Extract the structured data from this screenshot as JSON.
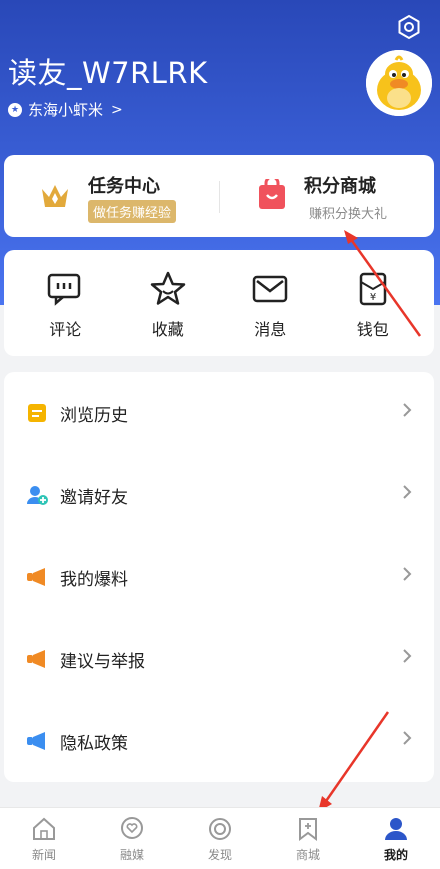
{
  "profile": {
    "username": "读友_W7RLRK",
    "level_label": "东海小虾米"
  },
  "top_card": {
    "task_title": "任务中心",
    "task_tag": "做任务赚经验",
    "shop_title": "积分商城",
    "shop_subtitle": "赚积分换大礼"
  },
  "quick_actions": [
    {
      "label": "评论",
      "icon": "comment-icon"
    },
    {
      "label": "收藏",
      "icon": "star-icon"
    },
    {
      "label": "消息",
      "icon": "mail-icon"
    },
    {
      "label": "钱包",
      "icon": "wallet-icon"
    }
  ],
  "menu": [
    {
      "label": "浏览历史",
      "icon": "history-icon",
      "color": "#f5b400"
    },
    {
      "label": "邀请好友",
      "icon": "invite-friend-icon",
      "color": "#3b8ef0"
    },
    {
      "label": "我的爆料",
      "icon": "megaphone-icon",
      "color": "#f08a24"
    },
    {
      "label": "建议与举报",
      "icon": "megaphone-icon",
      "color": "#f08a24"
    },
    {
      "label": "隐私政策",
      "icon": "megaphone-icon",
      "color": "#3b8ef0"
    }
  ],
  "tabs": [
    {
      "label": "新闻",
      "icon": "home-icon",
      "active": false
    },
    {
      "label": "融媒",
      "icon": "heart-badge-icon",
      "active": false
    },
    {
      "label": "发现",
      "icon": "discover-icon",
      "active": false
    },
    {
      "label": "商城",
      "icon": "bookmark-plus-icon",
      "active": false
    },
    {
      "label": "我的",
      "icon": "user-icon",
      "active": true
    }
  ],
  "colors": {
    "hero": "#3a5fd6",
    "accent_gold": "#dcb76b",
    "arrow_red": "#e8362a"
  }
}
